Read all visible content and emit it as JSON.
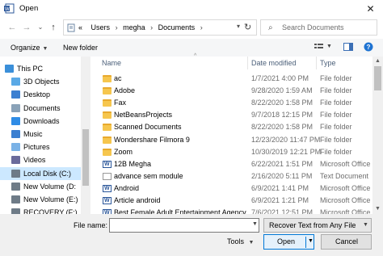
{
  "window": {
    "title": "Open",
    "close_glyph": "✕"
  },
  "nav": {
    "back_glyph": "←",
    "forward_glyph": "→",
    "recent_glyph": "⌄",
    "up_glyph": "↑",
    "breadcrumb_prefix": "«",
    "breadcrumb": [
      "Users",
      "megha",
      "Documents"
    ],
    "search_placeholder": "Search Documents"
  },
  "toolbar": {
    "organize_label": "Organize",
    "new_folder_label": "New folder"
  },
  "sidebar": {
    "items": [
      {
        "label": "This PC",
        "icon": "computer-icon",
        "color": "#3b8fd9"
      },
      {
        "label": "3D Objects",
        "icon": "cube-icon",
        "color": "#5aa9e6"
      },
      {
        "label": "Desktop",
        "icon": "desktop-icon",
        "color": "#3b7fd1"
      },
      {
        "label": "Documents",
        "icon": "documents-icon",
        "color": "#8aa2b8"
      },
      {
        "label": "Downloads",
        "icon": "download-icon",
        "color": "#2f8ce6"
      },
      {
        "label": "Music",
        "icon": "music-icon",
        "color": "#3b7fd1"
      },
      {
        "label": "Pictures",
        "icon": "pictures-icon",
        "color": "#7ab2e6"
      },
      {
        "label": "Videos",
        "icon": "videos-icon",
        "color": "#6b6b9b"
      },
      {
        "label": "Local Disk (C:)",
        "icon": "drive-icon",
        "color": "#6e7b87"
      },
      {
        "label": "New Volume (D:",
        "icon": "drive-icon",
        "color": "#6e7b87"
      },
      {
        "label": "New Volume (E:)",
        "icon": "drive-icon",
        "color": "#6e7b87"
      },
      {
        "label": "RECOVERY (F:)",
        "icon": "drive-icon",
        "color": "#6e7b87"
      }
    ]
  },
  "columns": {
    "name": "Name",
    "date": "Date modified",
    "type": "Type"
  },
  "files": [
    {
      "name": "ac",
      "date": "1/7/2021 4:00 PM",
      "type": "File folder",
      "kind": "folder"
    },
    {
      "name": "Adobe",
      "date": "9/28/2020 1:59 AM",
      "type": "File folder",
      "kind": "folder"
    },
    {
      "name": "Fax",
      "date": "8/22/2020 1:58 PM",
      "type": "File folder",
      "kind": "folder"
    },
    {
      "name": "NetBeansProjects",
      "date": "9/7/2018 12:15 PM",
      "type": "File folder",
      "kind": "folder"
    },
    {
      "name": "Scanned Documents",
      "date": "8/22/2020 1:58 PM",
      "type": "File folder",
      "kind": "folder"
    },
    {
      "name": "Wondershare Filmora 9",
      "date": "12/23/2020 11:47 PM",
      "type": "File folder",
      "kind": "folder"
    },
    {
      "name": "Zoom",
      "date": "10/30/2019 12:21 PM",
      "type": "File folder",
      "kind": "folder"
    },
    {
      "name": "12B Megha",
      "date": "6/22/2021 1:51 PM",
      "type": "Microsoft Office ...",
      "kind": "doc"
    },
    {
      "name": "advance sem module",
      "date": "2/16/2020 5:11 PM",
      "type": "Text Document",
      "kind": "txt"
    },
    {
      "name": "Android",
      "date": "6/9/2021 1:41 PM",
      "type": "Microsoft Office ...",
      "kind": "doc"
    },
    {
      "name": "Article android",
      "date": "6/9/2021 1:21 PM",
      "type": "Microsoft Office ...",
      "kind": "doc"
    },
    {
      "name": "Best Female Adult Entertainment Agency",
      "date": "7/6/2021 12:51 PM",
      "type": "Microsoft Office ...",
      "kind": "doc"
    }
  ],
  "bottom": {
    "file_name_label": "File name:",
    "file_name_value": "",
    "filter_value": "Recover Text from Any File",
    "tools_label": "Tools",
    "open_label": "Open",
    "cancel_label": "Cancel"
  }
}
